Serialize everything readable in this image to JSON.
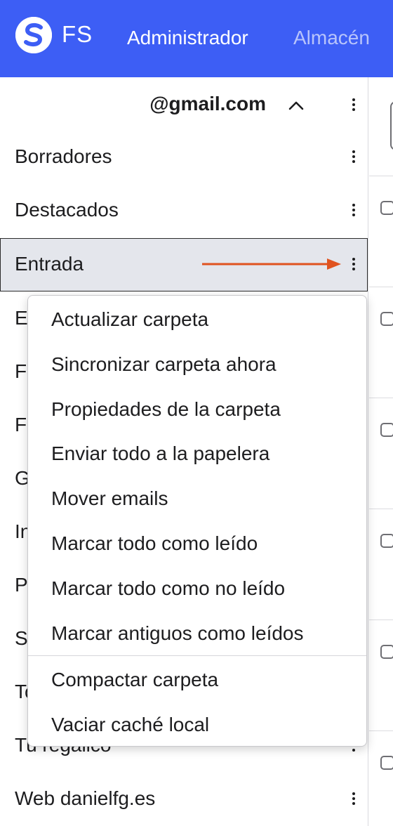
{
  "navbar": {
    "brand": "FS",
    "items": [
      {
        "label": "Administrador"
      },
      {
        "label": "Almacén"
      }
    ],
    "colors": {
      "background": "#3d5ef5",
      "active": "#ffffff",
      "inactive": "#b8c4fb"
    }
  },
  "sidebar": {
    "account": {
      "email": "@gmail.com",
      "chevron_icon": "chevron-up-icon",
      "menu_icon": "kebab-icon"
    },
    "folders": [
      {
        "label": "Borradores"
      },
      {
        "label": "Destacados"
      },
      {
        "label": "Entrada",
        "selected": true
      },
      {
        "label": "E"
      },
      {
        "label": "Fa"
      },
      {
        "label": "Fa"
      },
      {
        "label": "G"
      },
      {
        "label": "In"
      },
      {
        "label": "P"
      },
      {
        "label": "S"
      },
      {
        "label": "To"
      },
      {
        "label": "Tu regalico"
      },
      {
        "label": "Web danielfg.es"
      }
    ]
  },
  "context_menu": {
    "items": [
      {
        "label": "Actualizar carpeta"
      },
      {
        "label": "Sincronizar carpeta ahora"
      },
      {
        "label": "Propiedades de la carpeta"
      },
      {
        "label": "Enviar todo a la papelera"
      },
      {
        "label": "Mover emails"
      },
      {
        "label": "Marcar todo como leído"
      },
      {
        "label": "Marcar todo como no leído"
      },
      {
        "label": "Marcar antiguos como leídos"
      },
      {
        "label": "Compactar carpeta"
      },
      {
        "label": "Vaciar caché local"
      }
    ]
  },
  "annotation": {
    "arrow_color": "#e0531f"
  }
}
